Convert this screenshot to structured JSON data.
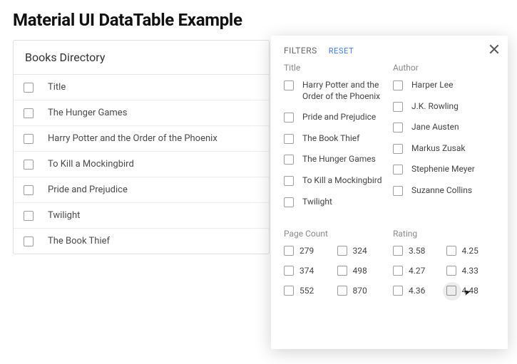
{
  "page": {
    "title": "Material UI DataTable Example"
  },
  "table": {
    "header": "Books Directory",
    "column_header": "Title",
    "rows": [
      "The Hunger Games",
      "Harry Potter and the Order of the Phoenix",
      "To Kill a Mockingbird",
      "Pride and Prejudice",
      "Twilight",
      "The Book Thief"
    ]
  },
  "filters": {
    "title_label": "FILTERS",
    "reset_label": "RESET",
    "sections": {
      "title": {
        "label": "Title",
        "options": [
          "Harry Potter and the Order of the Phoenix",
          "Pride and Prejudice",
          "The Book Thief",
          "The Hunger Games",
          "To Kill a Mockingbird",
          "Twilight"
        ]
      },
      "author": {
        "label": "Author",
        "options": [
          "Harper Lee",
          "J.K. Rowling",
          "Jane Austen",
          "Markus Zusak",
          "Stephenie Meyer",
          "Suzanne Collins"
        ]
      },
      "page_count": {
        "label": "Page Count",
        "options": [
          "279",
          "324",
          "374",
          "498",
          "552",
          "870"
        ]
      },
      "rating": {
        "label": "Rating",
        "options": [
          "3.58",
          "4.25",
          "4.27",
          "4.33",
          "4.36",
          "4.48"
        ]
      }
    }
  }
}
